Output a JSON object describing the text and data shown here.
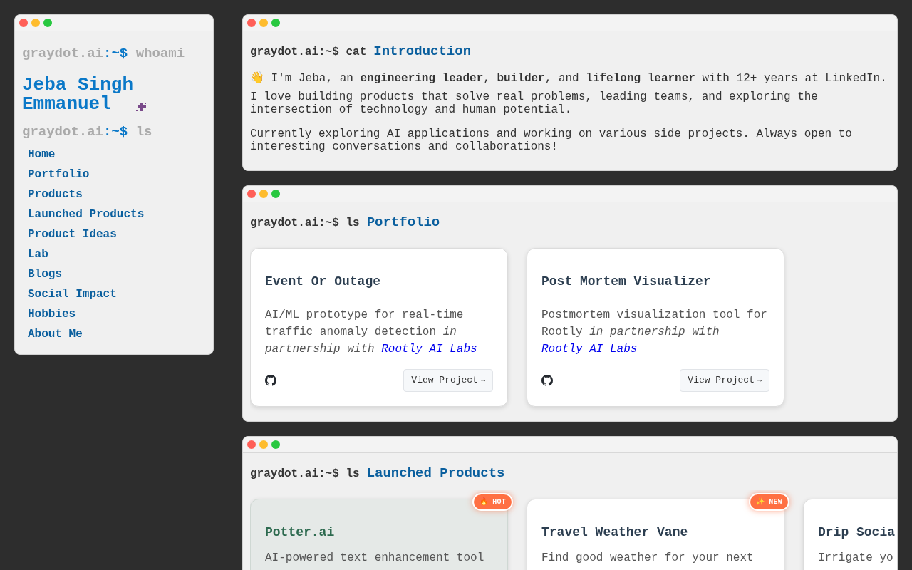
{
  "sidebar": {
    "prompt_host": "graydot.ai",
    "prompt_sign": ":~$",
    "prompt_command": "whoami",
    "name": "Jeba Singh Emmanuel",
    "list_prompt_host": "graydot.ai",
    "list_prompt_sign": ":~$",
    "list_command": "ls",
    "nav": [
      {
        "label": "Home"
      },
      {
        "label": "Portfolio"
      },
      {
        "label": "Products"
      },
      {
        "label": "Launched Products"
      },
      {
        "label": "Product Ideas"
      },
      {
        "label": "Lab"
      },
      {
        "label": "Blogs"
      },
      {
        "label": "Social Impact"
      },
      {
        "label": "Hobbies"
      },
      {
        "label": "About Me"
      }
    ]
  },
  "sections": [
    {
      "kind": "text",
      "prompt": "graydot.ai:~$ cat",
      "title": "Introduction",
      "emoji": "👋",
      "paragraphs": [
        "I'm Jeba, an **engineering leader**, **builder**, and **lifelong learner** with 12+ years at LinkedIn.",
        "I love building products that solve real problems, leading teams, and exploring the intersection of technology and human potential.",
        "Currently exploring AI applications and working on various side projects. Always open to interesting conversations and collaborations!"
      ]
    },
    {
      "kind": "cards",
      "prompt": "graydot.ai:~$ ls",
      "title": "Portfolio",
      "cards": [
        {
          "kind": "plain",
          "title": "Event Or Outage",
          "description": "AI/ML prototype for real-time traffic anomaly detection",
          "italic": "in partnership with",
          "link": "Rootly AI Labs",
          "button": "View Project",
          "arrow": "→"
        },
        {
          "kind": "plain",
          "title": "Post Mortem Visualizer",
          "description": "Postmortem visualization tool for Rootly",
          "italic": "in partnership with",
          "link": "Rootly AI Labs",
          "button": "View Project",
          "arrow": "→"
        }
      ]
    },
    {
      "kind": "cards",
      "prompt": "graydot.ai:~$ ls",
      "title": "Launched Products",
      "cards": [
        {
          "kind": "featured",
          "badge": "🔥 HOT",
          "title": "Potter.ai",
          "description": "AI-powered text enhancement tool"
        },
        {
          "kind": "plain",
          "badge": "✨ NEW",
          "title": "Travel Weather Vane",
          "description": "Find good weather for your next"
        },
        {
          "kind": "plain",
          "title": "Drip Socia",
          "description": "Irrigate yo"
        }
      ]
    }
  ]
}
